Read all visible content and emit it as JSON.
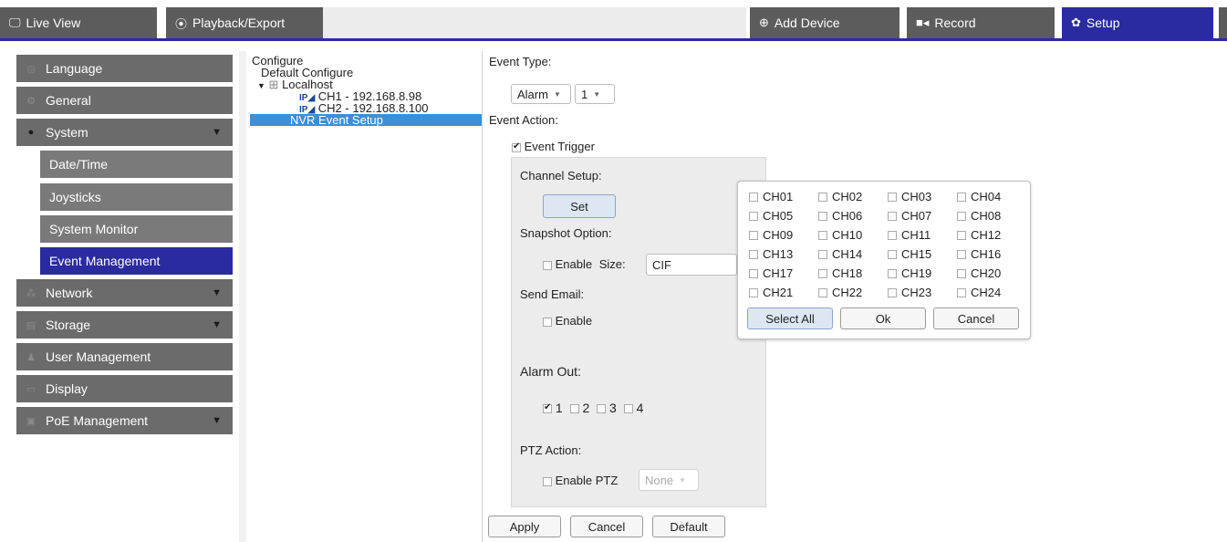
{
  "topbar": {
    "tabs": [
      {
        "label": "Live View",
        "icon": "monitor-icon"
      },
      {
        "label": "Playback/Export",
        "icon": "play-circle-icon"
      },
      {
        "label": "Add Device",
        "icon": "plus-circle-icon"
      },
      {
        "label": "Record",
        "icon": "video-camera-icon"
      },
      {
        "label": "Setup",
        "icon": "gear-icon"
      }
    ],
    "active_tab": "Setup",
    "accent_color": "#2a2ba0"
  },
  "sidebar": {
    "items": [
      {
        "label": "Language",
        "icon": "globe-icon"
      },
      {
        "label": "General",
        "icon": "gear-icon"
      },
      {
        "label": "System",
        "icon": "info-icon"
      },
      {
        "label": "Network",
        "icon": "network-icon"
      },
      {
        "label": "Storage",
        "icon": "storage-icon"
      },
      {
        "label": "User Management",
        "icon": "user-icon"
      },
      {
        "label": "Display",
        "icon": "monitor-icon"
      },
      {
        "label": "PoE Management",
        "icon": "poe-icon"
      }
    ],
    "system_sub": [
      "Date/Time",
      "Joysticks",
      "System Monitor",
      "Event Management"
    ],
    "active_sub": "Event Management"
  },
  "tree": {
    "root": "Configure",
    "default": "Default Configure",
    "host": "Localhost",
    "ch1": "CH1 - 192.168.8.98",
    "ch2": "CH2 - 192.168.8.100",
    "ip_badge": "IP",
    "selected": "NVR Event Setup"
  },
  "event": {
    "type_label": "Event Type:",
    "type_value": "Alarm",
    "type_num": "1",
    "action_label": "Event Action:",
    "trigger_label": "Event Trigger",
    "channel_setup": "Channel Setup:",
    "set_button": "Set",
    "snapshot_label": "Snapshot Option:",
    "snapshot_enable": "Enable",
    "size_label": "Size:",
    "size_value": "CIF",
    "email_label": "Send Email:",
    "email_enable": "Enable",
    "alarm_out_label": "Alarm Out:",
    "alarm_outs": [
      "1",
      "2",
      "3",
      "4"
    ],
    "ptz_label": "PTZ Action:",
    "ptz_enable": "Enable PTZ",
    "ptz_value": "None",
    "apply": "Apply",
    "cancel": "Cancel",
    "default": "Default"
  },
  "popup": {
    "channels": [
      "CH01",
      "CH02",
      "CH03",
      "CH04",
      "CH05",
      "CH06",
      "CH07",
      "CH08",
      "CH09",
      "CH10",
      "CH11",
      "CH12",
      "CH13",
      "CH14",
      "CH15",
      "CH16",
      "CH17",
      "CH18",
      "CH19",
      "CH20",
      "CH21",
      "CH22",
      "CH23",
      "CH24"
    ],
    "select_all": "Select All",
    "ok": "Ok",
    "cancel": "Cancel"
  }
}
